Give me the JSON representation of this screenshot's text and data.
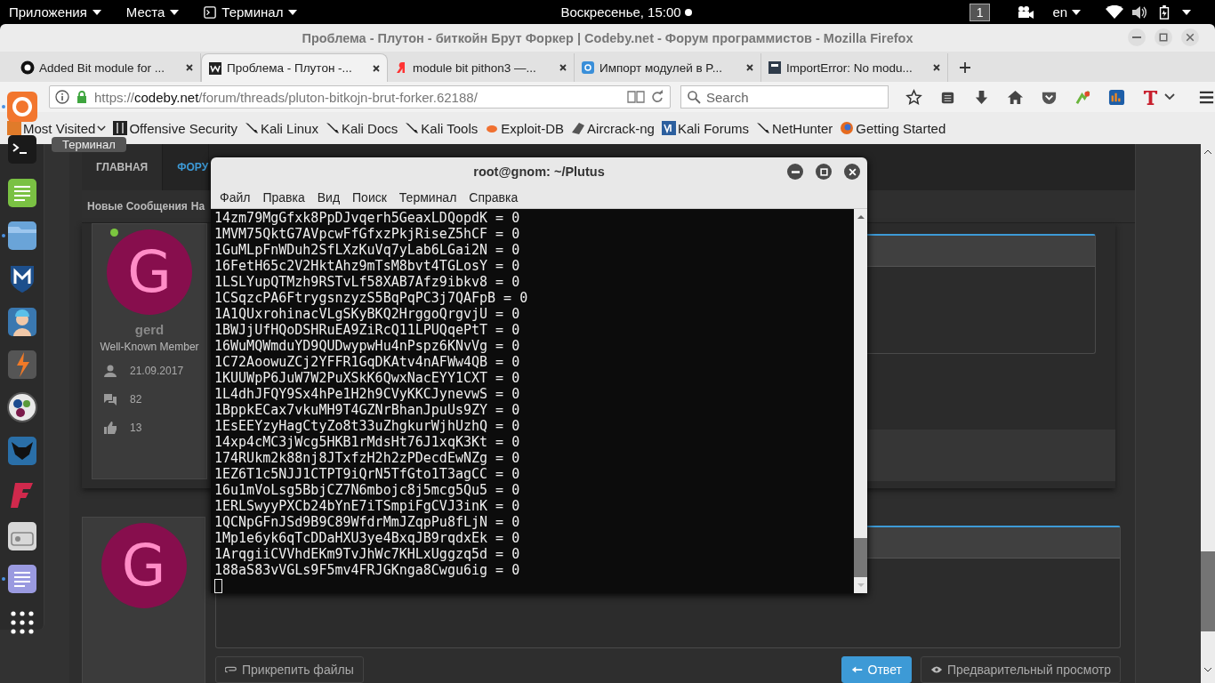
{
  "top_panel": {
    "menus": [
      {
        "label": "Приложения",
        "kind": "menu"
      },
      {
        "label": "Места",
        "kind": "menu"
      },
      {
        "label": "Терминал",
        "kind": "app"
      }
    ],
    "clock": "Воскресенье, 15:00",
    "workspace": "1",
    "keyboard": "en"
  },
  "browser": {
    "title": "Проблема - Плутон - биткойн Брут Форкер | Codeby.net - Форум программистов - Mozilla Firefox",
    "tabs": [
      {
        "label": "Added Bit module for ...",
        "selected": false,
        "kind": "github"
      },
      {
        "label": "Проблема - Плутон -...",
        "selected": true,
        "kind": "codeby"
      },
      {
        "label": "module bit pithon3 —...",
        "selected": false,
        "kind": "yandex"
      },
      {
        "label": "Импорт модулей в P...",
        "selected": false,
        "kind": "badge"
      },
      {
        "label": "ImportError: No modu...",
        "selected": false,
        "kind": "square"
      }
    ],
    "url": {
      "scheme": "https://",
      "domain": "codeby.net",
      "path": "/forum/threads/pluton-bitkojn-brut-forker.62188/"
    },
    "search": {
      "placeholder": "Search"
    },
    "bookmarks": [
      {
        "label": "Most Visited",
        "kind": "folder"
      },
      {
        "label": "Offensive Security",
        "kind": "offsec"
      },
      {
        "label": "Kali Linux",
        "kind": "dragon"
      },
      {
        "label": "Kali Docs",
        "kind": "dragon"
      },
      {
        "label": "Kali Tools",
        "kind": "dragon"
      },
      {
        "label": "Exploit-DB",
        "kind": "bug"
      },
      {
        "label": "Aircrack-ng",
        "kind": "plane"
      },
      {
        "label": "Kali Forums",
        "kind": "forum"
      },
      {
        "label": "NetHunter",
        "kind": "dragon"
      },
      {
        "label": "Getting Started",
        "kind": "globe"
      }
    ]
  },
  "dock": {
    "items": [
      {
        "kind": "browser",
        "running": true
      },
      {
        "kind": "terminal",
        "running": false
      },
      {
        "kind": "editor",
        "running": false
      },
      {
        "kind": "folder",
        "running": true
      },
      {
        "kind": "shield",
        "running": false
      },
      {
        "kind": "figure",
        "running": false
      },
      {
        "kind": "bolt",
        "running": false
      },
      {
        "kind": "balls",
        "running": false
      },
      {
        "kind": "bull",
        "running": false
      },
      {
        "kind": "flash",
        "running": false
      },
      {
        "kind": "radio",
        "running": false
      },
      {
        "kind": "notes",
        "running": true
      },
      {
        "kind": "grid",
        "running": false
      }
    ],
    "tooltip": "Терминал"
  },
  "forum": {
    "nav_tabs": [
      {
        "label": "ГЛАВНАЯ",
        "selected": false
      },
      {
        "label": "ФОРУ",
        "selected": true
      }
    ],
    "subnav": [
      "Новые Сообщения",
      "На"
    ],
    "post": {
      "avatar_letter": "G",
      "online": true,
      "username": "gerd",
      "role": "Well-Known Member",
      "joined": "21.09.2017",
      "messages": "82",
      "likes": "13"
    },
    "reply": {
      "avatar_letter": "G",
      "attach": "Прикрепить файлы",
      "submit": "Ответ",
      "preview": "Предварительный просмотр"
    }
  },
  "terminal": {
    "title": "root@gnom: ~/Plutus",
    "menu": [
      "Файл",
      "Правка",
      "Вид",
      "Поиск",
      "Терминал",
      "Справка"
    ],
    "lines": [
      "14zm79MgGfxk8PpDJvqerh5GeaxLDQopdK = 0",
      "1MVM75QktG7AVpcwFfGfxzPkjRiseZ5hCF = 0",
      "1GuMLpFnWDuh2SfLXzKuVq7yLab6LGai2N = 0",
      "16FetH65c2V2HktAhz9mTsM8bvt4TGLosY = 0",
      "1LSLYupQTMzh9RSTvLf58XAB7Afz9ibkv8 = 0",
      "1CSqzcPA6FtrygsnzyzS5BqPqPC3j7QAFpB = 0",
      "1A1QUxrohinacVLgSKyBKQ2HrggoQrgvjU = 0",
      "1BWJjUfHQoDSHRuEA9ZiRcQ11LPUQqePtT = 0",
      "16WuMQWmduYD9QUDwypwHu4nPspz6KNvVg = 0",
      "1C72AoowuZCj2YFFR1GqDKAtv4nAFWw4QB = 0",
      "1KUUWpP6JuW7W2PuXSkK6QwxNacEYY1CXT = 0",
      "1L4dhJFQY9Sx4hPe1H2h9CVyKKCJynevwS = 0",
      "1BppkECax7vkuMH9T4GZNrBhanJpuUs9ZY = 0",
      "1EsEEYzyHagCtyZo8t33uZhgkurWjhUzhQ = 0",
      "14xp4cMC3jWcg5HKB1rMdsHt76J1xqK3Kt = 0",
      "174RUkm2k88nj8JTxfzH2h2zPDecdEwNZg = 0",
      "1EZ6T1c5NJJ1CTPT9iQrN5TfGto1T3agCC = 0",
      "16u1mVoLsg5BbjCZ7N6mbojc8j5mcg5Qu5 = 0",
      "1ERLSwyyPXCb24bYnE7iTSmpiFgCVJ3inK = 0",
      "1QCNpGFnJSd9B9C89WfdrMmJZqpPu8fLjN = 0",
      "1Mp1e6yk6qTcDDaHXU3ye4BxqJB9rqdxEk = 0",
      "1ArqgiiCVVhdEKm9TvJhWc7KHLxUggzq5d = 0",
      "188aS83vVGLs9F5mv4FRJGKnga8Cwgu6ig = 0"
    ],
    "cursor": true
  }
}
